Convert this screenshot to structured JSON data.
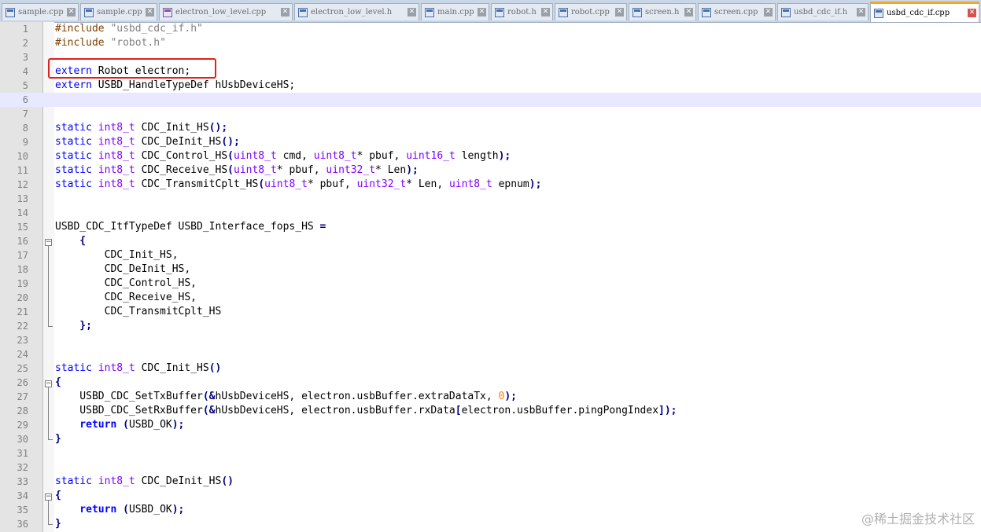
{
  "tabs": [
    {
      "label": "sample.cpp",
      "icon": "file-icon"
    },
    {
      "label": "sample.cpp",
      "icon": "file-icon"
    },
    {
      "label": "electron_low_level.cpp",
      "icon": "file-purple-icon"
    },
    {
      "label": "electron_low_level.h",
      "icon": "file-icon"
    },
    {
      "label": "main.cpp",
      "icon": "file-icon"
    },
    {
      "label": "robot.h",
      "icon": "file-icon"
    },
    {
      "label": "robot.cpp",
      "icon": "file-icon"
    },
    {
      "label": "screen.h",
      "icon": "file-icon"
    },
    {
      "label": "screen.cpp",
      "icon": "file-icon"
    },
    {
      "label": "usbd_cdc_if.h",
      "icon": "file-icon"
    },
    {
      "label": "usbd_cdc_if.cpp",
      "icon": "file-icon",
      "active": true
    }
  ],
  "close_glyph": "✕",
  "line_numbers": [
    "1",
    "2",
    "3",
    "4",
    "5",
    "6",
    "7",
    "8",
    "9",
    "10",
    "11",
    "12",
    "13",
    "14",
    "15",
    "16",
    "17",
    "18",
    "19",
    "20",
    "21",
    "22",
    "23",
    "24",
    "25",
    "26",
    "27",
    "28",
    "29",
    "30",
    "31",
    "32",
    "33",
    "34",
    "35",
    "36"
  ],
  "code": {
    "l1": [
      "#include ",
      "\"usbd_cdc_if.h\""
    ],
    "l2": [
      "#include ",
      "\"robot.h\""
    ],
    "l4": [
      "extern",
      " Robot electron;"
    ],
    "l5": [
      "extern",
      " USBD_HandleTypeDef hUsbDeviceHS;"
    ],
    "sig8": [
      "static",
      "int8_t",
      " CDC_Init_HS",
      "();"
    ],
    "sig9": [
      "static",
      "int8_t",
      " CDC_DeInit_HS",
      "();"
    ],
    "sig10": [
      "static",
      "int8_t",
      " CDC_Control_HS",
      "(",
      "uint8_t",
      " cmd, ",
      "uint8_t",
      "* pbuf, ",
      "uint16_t",
      " length",
      ");"
    ],
    "sig11": [
      "static",
      "int8_t",
      " CDC_Receive_HS",
      "(",
      "uint8_t",
      "* pbuf, ",
      "uint32_t",
      "* Len",
      ");"
    ],
    "sig12": [
      "static",
      "int8_t",
      " CDC_TransmitCplt_HS",
      "(",
      "uint8_t",
      "* pbuf, ",
      "uint32_t",
      "* Len, ",
      "uint8_t",
      " epnum",
      ");"
    ],
    "l15": [
      "USBD_CDC_ItfTypeDef USBD_Interface_fops_HS ",
      "="
    ],
    "l16": "    {",
    "l17": "        CDC_Init_HS,",
    "l18": "        CDC_DeInit_HS,",
    "l19": "        CDC_Control_HS,",
    "l20": "        CDC_Receive_HS,",
    "l21": "        CDC_TransmitCplt_HS",
    "l22": "    };",
    "l25": [
      "static",
      "int8_t",
      " CDC_Init_HS",
      "()"
    ],
    "l26": "{",
    "l27": [
      "    USBD_CDC_SetTxBuffer",
      "(&",
      "hUsbDeviceHS, electron.usbBuffer.extraDataTx, ",
      "0",
      ");"
    ],
    "l28": [
      "    USBD_CDC_SetRxBuffer",
      "(&",
      "hUsbDeviceHS, electron.usbBuffer.rxData",
      "[",
      "electron.usbBuffer.pingPongIndex",
      "]);"
    ],
    "l29": [
      "    return",
      " (",
      "USBD_OK",
      ");"
    ],
    "l30": "}",
    "l33": [
      "static",
      "int8_t",
      " CDC_DeInit_HS",
      "()"
    ],
    "l34": "{",
    "l35": [
      "    return",
      " (",
      "USBD_OK",
      ");"
    ],
    "l36": "}"
  },
  "watermark": "@稀土掘金技术社区",
  "colors": {
    "keyword": "#0000ff",
    "type": "#8000ff",
    "string": "#808080",
    "number": "#ff8000",
    "highlight_box": "#e0211b",
    "active_tab_accent": "#f5a623"
  }
}
